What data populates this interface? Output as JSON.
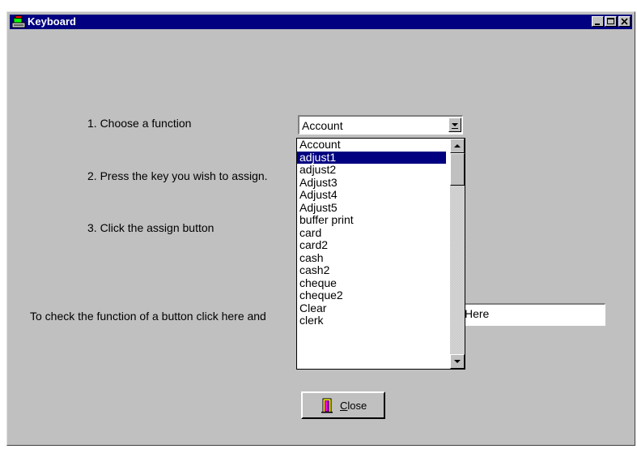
{
  "window": {
    "title": "Keyboard"
  },
  "steps": {
    "step1": "1. Choose a function",
    "step2": "2. Press the key you wish to assign.",
    "step3": "3. Click the assign button"
  },
  "function_combo": {
    "selected_value": "Account"
  },
  "function_list": {
    "items": [
      "Account",
      "adjust1",
      "adjust2",
      "Adjust3",
      "Adjust4",
      "Adjust5",
      "buffer print",
      "card",
      "card2",
      "cash",
      "cash2",
      "cheque",
      "cheque2",
      "Clear",
      "clerk"
    ],
    "highlighted": "adjust1"
  },
  "check_function": {
    "label": "To check the function of a button click here and",
    "input_value": "Here"
  },
  "close_button": {
    "label_underlined": "C",
    "label_rest": "lose"
  },
  "colors": {
    "titlebar": "#000080",
    "face": "#c0c0c0",
    "selection": "#000080"
  }
}
